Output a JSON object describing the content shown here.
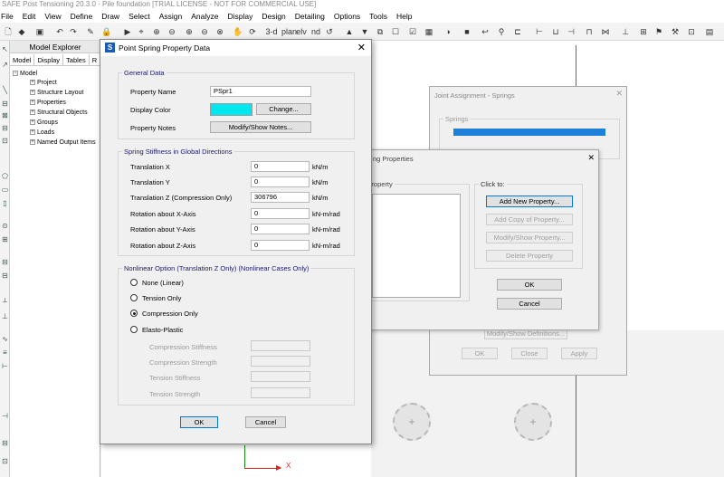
{
  "app": {
    "title": "SAFE Post Tensioning 20.3.0 - Pile foundation  [TRIAL LICENSE - NOT FOR COMMERCIAL USE]",
    "menu": [
      "File",
      "Edit",
      "View",
      "Define",
      "Draw",
      "Select",
      "Assign",
      "Analyze",
      "Display",
      "Design",
      "Detailing",
      "Options",
      "Tools",
      "Help"
    ],
    "toolbar_text": {
      "three_d": "3-d",
      "plan": "plаn",
      "elev": "elv",
      "nd": "nd"
    }
  },
  "explorer": {
    "title": "Model Explorer",
    "tabs": [
      "Model",
      "Display",
      "Tables",
      "R"
    ],
    "root": "Model",
    "items": [
      "Project",
      "Structure Layout",
      "Properties",
      "Structural Objects",
      "Groups",
      "Loads",
      "Named Output Items"
    ]
  },
  "canvas": {
    "axis_x": "X"
  },
  "joint_assignment": {
    "title": "Joint Assignment - Springs",
    "group": "Springs",
    "modify_button": "Modify/Show Definitions...",
    "ok": "OK",
    "close": "Close",
    "apply": "Apply"
  },
  "spring_properties": {
    "title": "ng Properties",
    "list_header": "ng Property",
    "click_to": "Click to:",
    "add_new": "Add New Property...",
    "add_copy": "Add Copy of Property...",
    "modify": "Modify/Show Property...",
    "delete": "Delete Property",
    "ok": "OK",
    "cancel": "Cancel"
  },
  "dialog": {
    "title": "Point Spring Property Data",
    "general": {
      "label": "General Data",
      "name_label": "Property Name",
      "name_value": "PSpr1",
      "color_label": "Display Color",
      "color_value": "#00e8ef",
      "change_button": "Change...",
      "notes_label": "Property Notes",
      "notes_button": "Modify/Show Notes..."
    },
    "stiffness": {
      "label": "Spring Stiffness in Global Directions",
      "rows": [
        {
          "label": "Translation  X",
          "value": "0",
          "unit": "kN/m"
        },
        {
          "label": "Translation  Y",
          "value": "0",
          "unit": "kN/m"
        },
        {
          "label": "Translation  Z  (Compression Only)",
          "value": "306796",
          "unit": "kN/m"
        },
        {
          "label": "Rotation about  X-Axis",
          "value": "0",
          "unit": "kN-m/rad"
        },
        {
          "label": "Rotation about  Y-Axis",
          "value": "0",
          "unit": "kN-m/rad"
        },
        {
          "label": "Rotation about  Z-Axis",
          "value": "0",
          "unit": "kN-m/rad"
        }
      ]
    },
    "nonlinear": {
      "label": "Nonlinear Option  (Translation Z Only)  (Nonlinear Cases Only)",
      "options": [
        "None (Linear)",
        "Tension Only",
        "Compression Only",
        "Elasto-Plastic"
      ],
      "selected": "Compression Only",
      "ep_fields": [
        "Compression Stiffness",
        "Compression Strength",
        "Tension Stiffness",
        "Tension Strength"
      ]
    },
    "ok": "OK",
    "cancel": "Cancel"
  }
}
